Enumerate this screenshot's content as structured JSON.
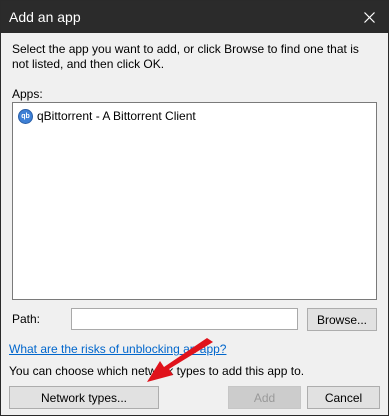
{
  "window": {
    "title": "Add an app",
    "close_icon": "close-icon"
  },
  "description": "Select the app you want to add, or click Browse to find one that is not listed, and then click OK.",
  "apps": {
    "label": "Apps:",
    "items": [
      {
        "icon": "qbittorrent-icon",
        "icon_text": "qb",
        "label": "qBittorrent - A Bittorrent Client"
      }
    ]
  },
  "path": {
    "label": "Path:",
    "value": "",
    "browse_label": "Browse..."
  },
  "risk_link": "What are the risks of unblocking an app?",
  "choose_text": "You can choose which network types to add this app to.",
  "buttons": {
    "network_types": "Network types...",
    "add": "Add",
    "cancel": "Cancel"
  },
  "colors": {
    "titlebar": "#2b2b2b",
    "link": "#0066cc",
    "annotation_arrow": "#e0121b"
  }
}
